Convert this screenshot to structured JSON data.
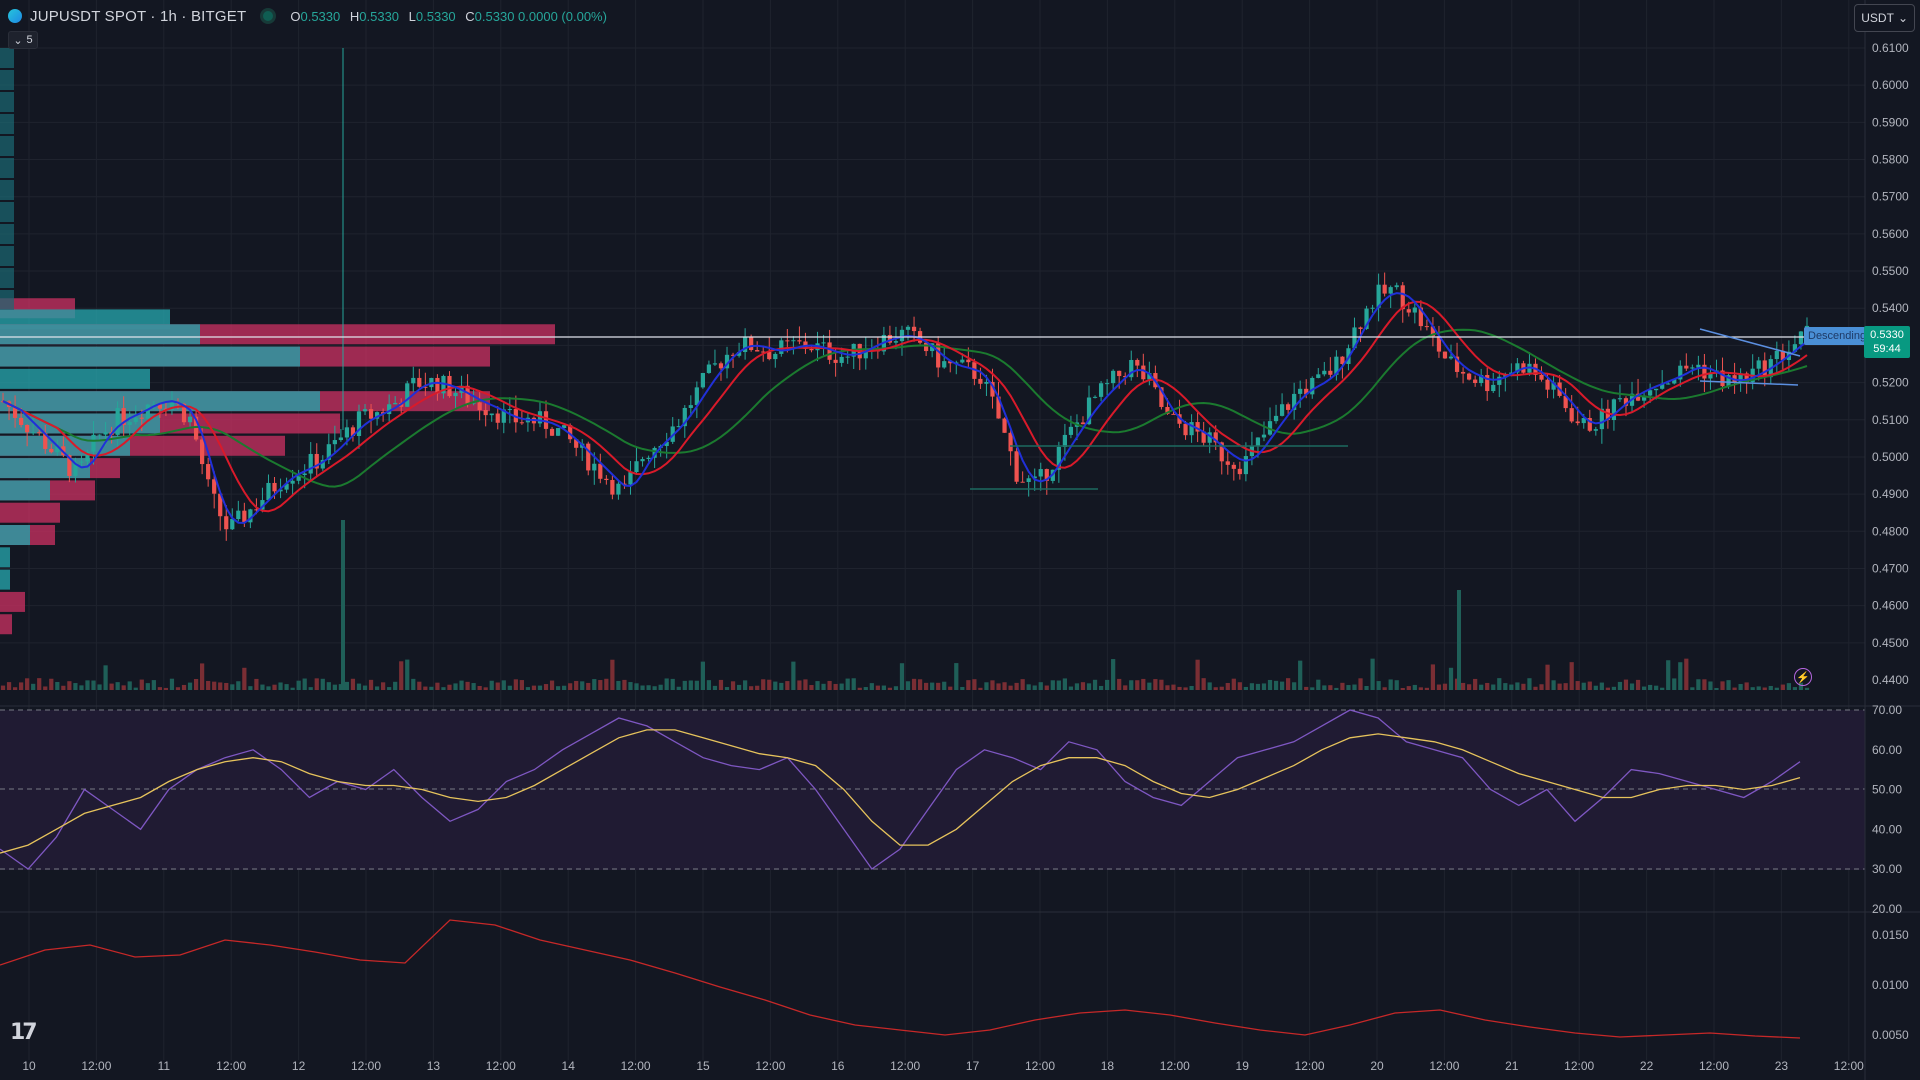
{
  "header": {
    "symbol_title": "JUPUSDT SPOT · 1h · BITGET",
    "ohlc": [
      {
        "k": "O",
        "v": "0.5330"
      },
      {
        "k": "H",
        "v": "0.5330"
      },
      {
        "k": "L",
        "v": "0.5330"
      },
      {
        "k": "C",
        "v": "0.5330 0.0000 (0.00%)"
      }
    ],
    "collapse_count": "5",
    "currency": "USDT"
  },
  "price_tag": {
    "price": "0.5330",
    "countdown": "59:44"
  },
  "drawing_label": "Descending",
  "price_axis": [
    "0.6100",
    "0.6000",
    "0.5900",
    "0.5800",
    "0.5700",
    "0.5600",
    "0.5500",
    "0.5400",
    "0.5200",
    "0.5100",
    "0.5000",
    "0.4900",
    "0.4800",
    "0.4700",
    "0.4600",
    "0.4500",
    "0.4400"
  ],
  "rsi_axis": [
    "70.00",
    "60.00",
    "50.00",
    "40.00",
    "30.00",
    "20.00"
  ],
  "vol_axis": [
    "0.0150",
    "0.0100",
    "0.0050"
  ],
  "time_axis": [
    "10",
    "12:00",
    "11",
    "12:00",
    "12",
    "12:00",
    "13",
    "12:00",
    "14",
    "12:00",
    "15",
    "12:00",
    "16",
    "12:00",
    "17",
    "12:00",
    "18",
    "12:00",
    "19",
    "12:00",
    "20",
    "12:00",
    "21",
    "12:00",
    "22",
    "12:00",
    "23",
    "12:00"
  ],
  "colors": {
    "up": "#26a69a",
    "down": "#ef5350",
    "rsi": "#7e57c2",
    "rsi_ma": "#e6c35c",
    "bg": "#131722"
  },
  "chart_data": {
    "type": "line",
    "price_ylim": [
      0.44,
      0.61
    ],
    "price_close": [
      0.515,
      0.51,
      0.505,
      0.5,
      0.495,
      0.505,
      0.51,
      0.512,
      0.515,
      0.515,
      0.51,
      0.49,
      0.48,
      0.485,
      0.49,
      0.495,
      0.497,
      0.5,
      0.505,
      0.51,
      0.512,
      0.515,
      0.52,
      0.52,
      0.518,
      0.515,
      0.513,
      0.51,
      0.51,
      0.509,
      0.505,
      0.5,
      0.495,
      0.49,
      0.5,
      0.505,
      0.51,
      0.518,
      0.525,
      0.53,
      0.53,
      0.528,
      0.53,
      0.53,
      0.528,
      0.527,
      0.53,
      0.532,
      0.533,
      0.53,
      0.525,
      0.524,
      0.522,
      0.51,
      0.495,
      0.492,
      0.5,
      0.508,
      0.515,
      0.52,
      0.525,
      0.52,
      0.51,
      0.508,
      0.505,
      0.5,
      0.498,
      0.505,
      0.512,
      0.518,
      0.52,
      0.525,
      0.535,
      0.543,
      0.545,
      0.54,
      0.532,
      0.525,
      0.522,
      0.52,
      0.523,
      0.525,
      0.52,
      0.515,
      0.508,
      0.51,
      0.515,
      0.518,
      0.52,
      0.522,
      0.525,
      0.522,
      0.52,
      0.522,
      0.525,
      0.529,
      0.533
    ],
    "rsi": [
      35,
      30,
      38,
      50,
      45,
      40,
      50,
      55,
      58,
      60,
      55,
      48,
      52,
      50,
      55,
      48,
      42,
      45,
      52,
      55,
      60,
      64,
      68,
      66,
      62,
      58,
      56,
      55,
      58,
      50,
      40,
      30,
      35,
      45,
      55,
      60,
      58,
      55,
      62,
      60,
      52,
      48,
      46,
      52,
      58,
      60,
      62,
      66,
      70,
      68,
      62,
      60,
      58,
      50,
      46,
      50,
      42,
      48,
      55,
      54,
      52,
      50,
      48,
      52,
      57
    ],
    "rsi_ma": [
      34,
      36,
      40,
      44,
      46,
      48,
      52,
      55,
      57,
      58,
      57,
      54,
      52,
      51,
      51,
      50,
      48,
      47,
      48,
      51,
      55,
      59,
      63,
      65,
      65,
      63,
      61,
      59,
      58,
      56,
      50,
      42,
      36,
      36,
      40,
      46,
      52,
      56,
      58,
      58,
      56,
      52,
      49,
      48,
      50,
      53,
      56,
      60,
      63,
      64,
      63,
      62,
      60,
      57,
      54,
      52,
      50,
      48,
      48,
      50,
      51,
      51,
      50,
      51,
      53
    ],
    "vol_indicator": [
      0.012,
      0.0135,
      0.014,
      0.0128,
      0.013,
      0.0145,
      0.014,
      0.0133,
      0.0125,
      0.0122,
      0.0165,
      0.016,
      0.0145,
      0.0135,
      0.0125,
      0.0112,
      0.0098,
      0.0085,
      0.007,
      0.006,
      0.0055,
      0.005,
      0.0055,
      0.0065,
      0.0072,
      0.0075,
      0.007,
      0.0062,
      0.0055,
      0.005,
      0.006,
      0.0072,
      0.0075,
      0.0065,
      0.0058,
      0.0052,
      0.0048,
      0.005,
      0.0052,
      0.0049,
      0.0047
    ]
  }
}
